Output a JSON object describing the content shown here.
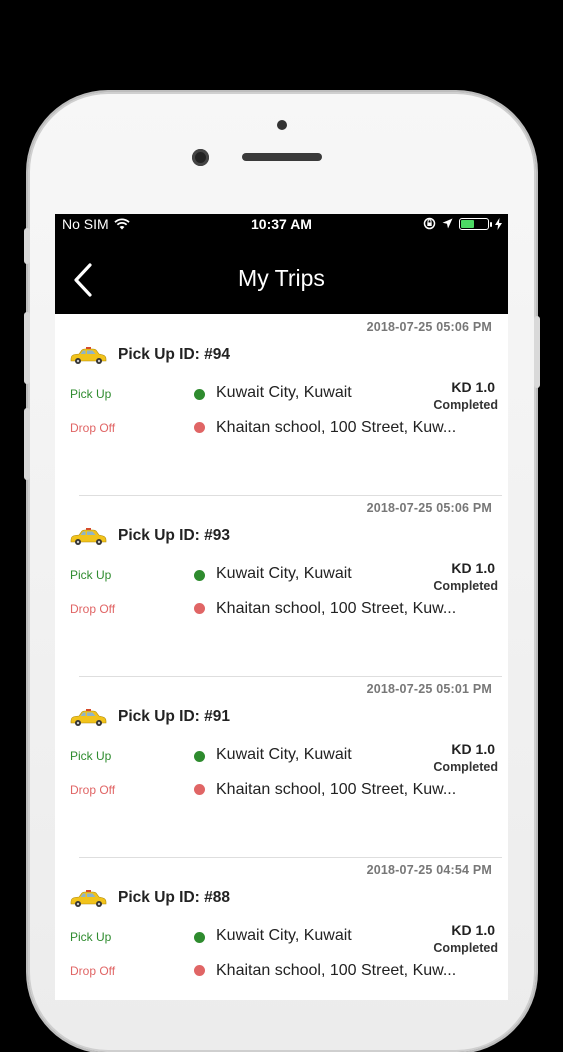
{
  "status_bar": {
    "carrier": "No SIM",
    "time": "10:37 AM"
  },
  "header": {
    "title": "My Trips"
  },
  "labels": {
    "pick_up": "Pick Up",
    "drop_off": "Drop Off"
  },
  "trips": [
    {
      "date": "2018-07-25 05:06 PM",
      "id": "Pick Up ID: #94",
      "pickup": "Kuwait City, Kuwait",
      "dropoff": "Khaitan school, 100 Street, Kuw...",
      "fare": "KD 1.0",
      "status": "Completed"
    },
    {
      "date": "2018-07-25 05:06 PM",
      "id": "Pick Up ID: #93",
      "pickup": "Kuwait City, Kuwait",
      "dropoff": "Khaitan school, 100 Street, Kuw...",
      "fare": "KD 1.0",
      "status": "Completed"
    },
    {
      "date": "2018-07-25 05:01 PM",
      "id": "Pick Up ID: #91",
      "pickup": "Kuwait City, Kuwait",
      "dropoff": "Khaitan school, 100 Street, Kuw...",
      "fare": "KD 1.0",
      "status": "Completed"
    },
    {
      "date": "2018-07-25 04:54 PM",
      "id": "Pick Up ID: #88",
      "pickup": "Kuwait City, Kuwait",
      "dropoff": "Khaitan school, 100 Street, Kuw...",
      "fare": "KD 1.0",
      "status": "Completed"
    }
  ],
  "colors": {
    "pickup": "#2e8b2e",
    "dropoff": "#e06565",
    "bar": "#000000",
    "battery": "#4cd964",
    "taxi": "#f2c31b"
  },
  "battery_level": 0.5
}
